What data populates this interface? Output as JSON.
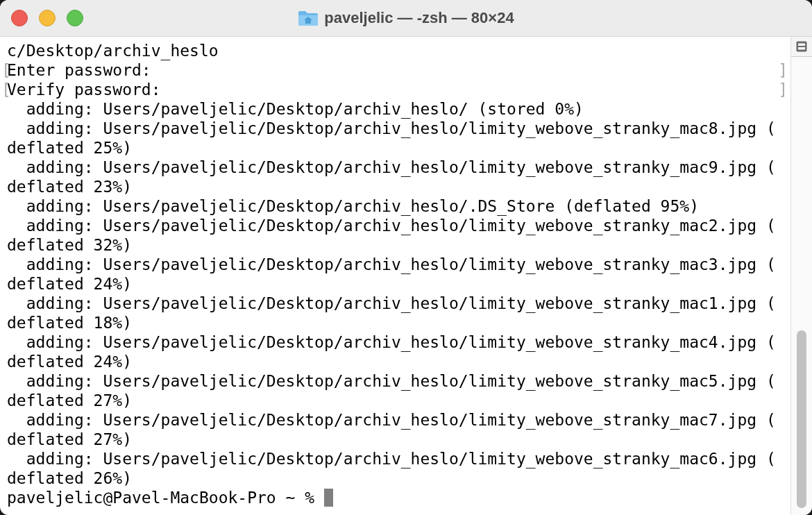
{
  "window": {
    "title": "paveljelic — -zsh — 80×24"
  },
  "lines": [
    {
      "text": "c/Desktop/archiv_heslo"
    },
    {
      "text": "Enter password:",
      "mark_left": "[",
      "mark_right": "]"
    },
    {
      "text": "Verify password:",
      "mark_left": "[",
      "mark_right": "]"
    },
    {
      "text": "  adding: Users/paveljelic/Desktop/archiv_heslo/ (stored 0%)"
    },
    {
      "text": "  adding: Users/paveljelic/Desktop/archiv_heslo/limity_webove_stranky_mac8.jpg ("
    },
    {
      "text": "deflated 25%)"
    },
    {
      "text": "  adding: Users/paveljelic/Desktop/archiv_heslo/limity_webove_stranky_mac9.jpg ("
    },
    {
      "text": "deflated 23%)"
    },
    {
      "text": "  adding: Users/paveljelic/Desktop/archiv_heslo/.DS_Store (deflated 95%)"
    },
    {
      "text": "  adding: Users/paveljelic/Desktop/archiv_heslo/limity_webove_stranky_mac2.jpg ("
    },
    {
      "text": "deflated 32%)"
    },
    {
      "text": "  adding: Users/paveljelic/Desktop/archiv_heslo/limity_webove_stranky_mac3.jpg ("
    },
    {
      "text": "deflated 24%)"
    },
    {
      "text": "  adding: Users/paveljelic/Desktop/archiv_heslo/limity_webove_stranky_mac1.jpg ("
    },
    {
      "text": "deflated 18%)"
    },
    {
      "text": "  adding: Users/paveljelic/Desktop/archiv_heslo/limity_webove_stranky_mac4.jpg ("
    },
    {
      "text": "deflated 24%)"
    },
    {
      "text": "  adding: Users/paveljelic/Desktop/archiv_heslo/limity_webove_stranky_mac5.jpg ("
    },
    {
      "text": "deflated 27%)"
    },
    {
      "text": "  adding: Users/paveljelic/Desktop/archiv_heslo/limity_webove_stranky_mac7.jpg ("
    },
    {
      "text": "deflated 27%)"
    },
    {
      "text": "  adding: Users/paveljelic/Desktop/archiv_heslo/limity_webove_stranky_mac6.jpg ("
    },
    {
      "text": "deflated 26%)"
    }
  ],
  "prompt": {
    "text": "paveljelic@Pavel-MacBook-Pro ~ % "
  }
}
